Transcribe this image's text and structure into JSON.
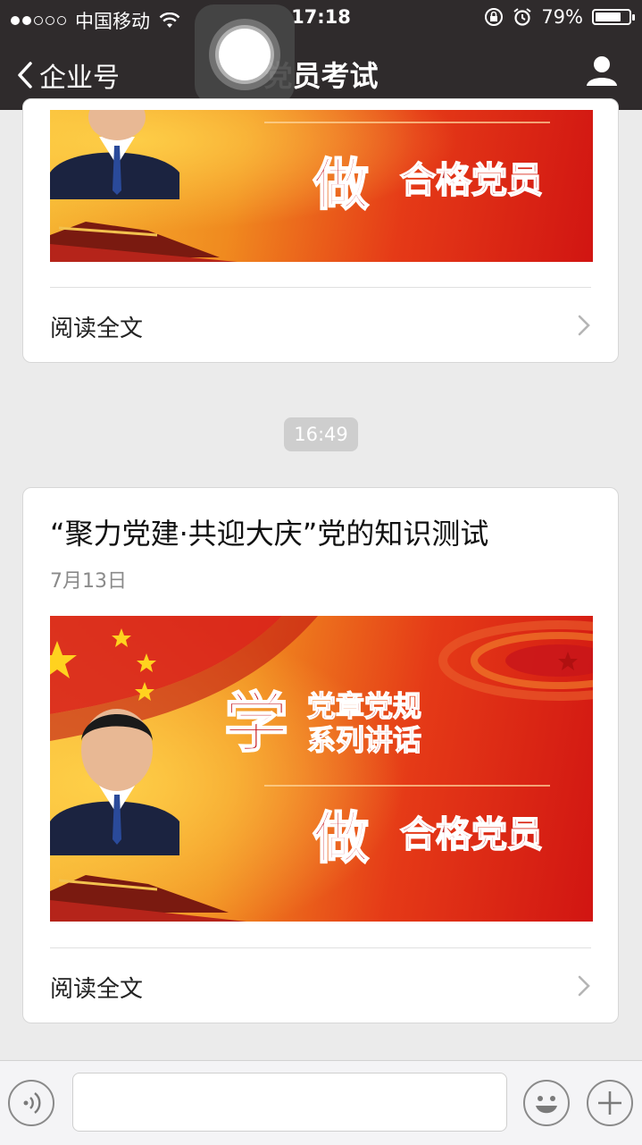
{
  "status_bar": {
    "carrier": "中国移动",
    "time": "17:18",
    "battery_percent": "79%",
    "battery_level": 0.79,
    "signal_bars_on": 2,
    "signal_bars_total": 5
  },
  "nav": {
    "back_label": "企业号",
    "title": "党员考试"
  },
  "cards": [
    {
      "banner": {
        "big_char": "做",
        "slogan": "合格党员"
      },
      "read_more": "阅读全文"
    },
    {
      "title": "“聚力党建·共迎大庆”党的知识测试",
      "date": "7月13日",
      "banner": {
        "big_char_top": "学",
        "top_line1": "党章党规",
        "top_line2": "系列讲话",
        "big_char": "做",
        "slogan": "合格党员"
      },
      "read_more": "阅读全文"
    }
  ],
  "timestamp": "16:49",
  "colors": {
    "nav_bg": "#2f2b2c",
    "page_bg": "#ebebeb",
    "banner_red": "#d11512",
    "banner_orange": "#f08a1f"
  }
}
